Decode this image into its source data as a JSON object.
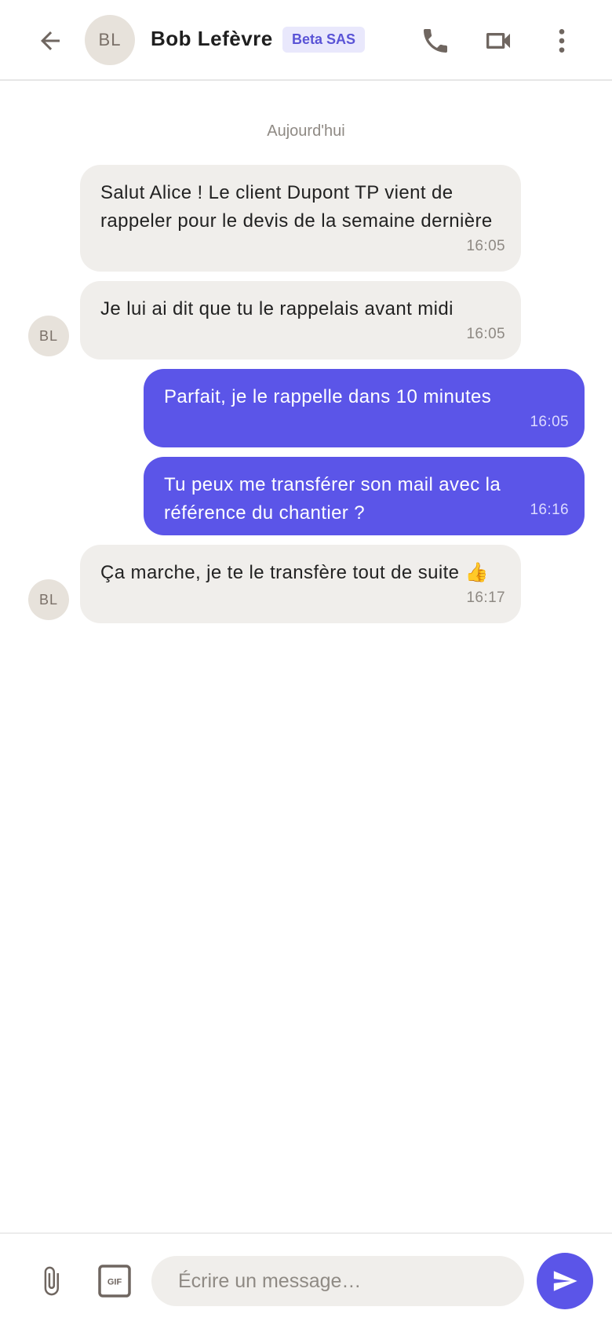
{
  "header": {
    "avatar_initials": "BL",
    "contact_name": "Bob Lefèvre",
    "company_badge": "Beta SAS",
    "icons": [
      "arrow-left-icon",
      "phone-icon",
      "video-camera-icon",
      "more-vertical-icon"
    ]
  },
  "conversation": {
    "date_separator": "Aujourd'hui",
    "messages": [
      {
        "direction": "in",
        "text": "Salut Alice ! Le client Dupont TP vient de rappeler pour le devis de la semaine dernière",
        "time": "16:05",
        "show_avatar": false
      },
      {
        "direction": "in",
        "text": "Je lui ai dit que tu le rappelais avant midi",
        "time": "16:05",
        "show_avatar": true,
        "avatar_initials": "BL"
      },
      {
        "direction": "out",
        "text": "Parfait, je le rappelle dans 10 minutes",
        "time": "16:05"
      },
      {
        "direction": "out",
        "text": "Tu peux me transférer son mail avec la référence du chantier ?",
        "time": "16:16"
      },
      {
        "direction": "in",
        "text": "Ça marche, je te le transfère tout de suite 👍",
        "time": "16:17",
        "show_avatar": true,
        "avatar_initials": "BL"
      }
    ]
  },
  "composer": {
    "placeholder": "Écrire un message…",
    "value": "",
    "gif_label": "GIF",
    "icons": [
      "paperclip-icon",
      "gif-icon",
      "send-icon"
    ]
  },
  "colors": {
    "accent": "#5b55e8",
    "incoming_bubble": "#f0eeeb",
    "badge_bg": "#e9e8fc",
    "badge_text": "#5a54d6",
    "avatar_bg": "#e7e2db"
  }
}
